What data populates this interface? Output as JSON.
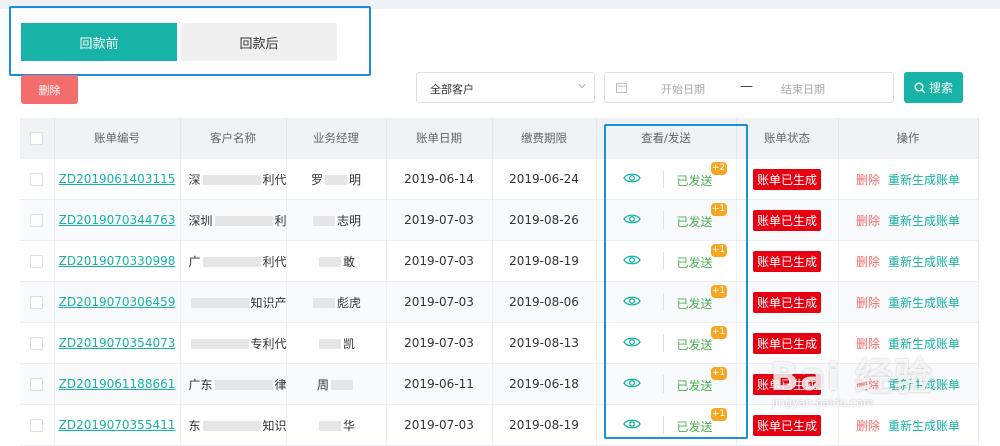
{
  "tabs": {
    "before": "回款前",
    "after": "回款后"
  },
  "toolbar": {
    "delete_label": "删除",
    "customer_select": "全部客户",
    "start_placeholder": "开始日期",
    "date_sep": "—",
    "end_placeholder": "结束日期",
    "search_label": "搜索"
  },
  "table": {
    "headers": [
      "账单编号",
      "客户名称",
      "业务经理",
      "账单日期",
      "缴费期限",
      "查看/发送",
      "账单状态",
      "操作"
    ],
    "rows": [
      {
        "id": "ZD2019061403115",
        "cust_a": "深",
        "cust_b": "利代...",
        "mgr_a": "罗",
        "mgr_b": "明",
        "bill_date": "2019-06-14",
        "due": "2019-06-24",
        "sent": "已发送",
        "count": "+2",
        "status": "账单已生成",
        "del": "删除",
        "regen": "重新生成账单"
      },
      {
        "id": "ZD2019070344763",
        "cust_a": "深圳",
        "cust_b": "利代...",
        "mgr_a": "",
        "mgr_b": "志明",
        "bill_date": "2019-07-03",
        "due": "2019-08-26",
        "sent": "已发送",
        "count": "+1",
        "status": "账单已生成",
        "del": "删除",
        "regen": "重新生成账单"
      },
      {
        "id": "ZD2019070330998",
        "cust_a": "广",
        "cust_b": "利代...",
        "mgr_a": "",
        "mgr_b": "敢",
        "bill_date": "2019-07-03",
        "due": "2019-08-19",
        "sent": "已发送",
        "count": "+1",
        "status": "账单已生成",
        "del": "删除",
        "regen": "重新生成账单"
      },
      {
        "id": "ZD2019070306459",
        "cust_a": "",
        "cust_b": "知识产...",
        "mgr_a": "",
        "mgr_b": "彪虎",
        "bill_date": "2019-07-03",
        "due": "2019-08-06",
        "sent": "已发送",
        "count": "+1",
        "status": "账单已生成",
        "del": "删除",
        "regen": "重新生成账单"
      },
      {
        "id": "ZD2019070354073",
        "cust_a": "",
        "cust_b": "专利代...",
        "mgr_a": "",
        "mgr_b": "凯",
        "bill_date": "2019-07-03",
        "due": "2019-08-13",
        "sent": "已发送",
        "count": "+1",
        "status": "账单已生成",
        "del": "删除",
        "regen": "重新生成账单"
      },
      {
        "id": "ZD2019061188661",
        "cust_a": "广东",
        "cust_b": "律师事...",
        "mgr_a": "周",
        "mgr_b": "",
        "bill_date": "2019-06-11",
        "due": "2019-06-18",
        "sent": "已发送",
        "count": "+1",
        "status": "账单已生成",
        "del": "删除",
        "regen": "重新生成账单"
      },
      {
        "id": "ZD2019070355411",
        "cust_a": "东",
        "cust_b": "知识...",
        "mgr_a": "",
        "mgr_b": "华",
        "bill_date": "2019-07-03",
        "due": "2019-08-19",
        "sent": "已发送",
        "count": "+1",
        "status": "账单已生成",
        "del": "删除",
        "regen": "重新生成账单"
      }
    ]
  },
  "watermark": {
    "main": "Bai 经验",
    "sub": "jingyan.baidu.com"
  },
  "colors": {
    "primary": "#17b3a6",
    "danger": "#f36d6d",
    "status_red": "#e60012",
    "badge": "#f5a623",
    "sent_green": "#4caf50",
    "annotation_blue": "#1a8fdc"
  }
}
